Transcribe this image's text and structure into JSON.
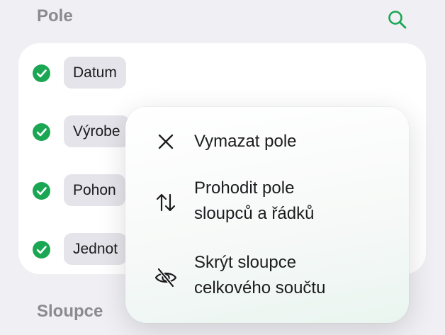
{
  "sections": {
    "fields_title": "Pole",
    "columns_title": "Sloupce"
  },
  "fields": [
    {
      "label": "Datum"
    },
    {
      "label": "Výrobe"
    },
    {
      "label": "Pohon"
    },
    {
      "label": "Jednot"
    }
  ],
  "menu": {
    "items": [
      {
        "icon": "close-icon",
        "line1": "Vymazat pole",
        "line2": ""
      },
      {
        "icon": "swap-arrows-icon",
        "line1": "Prohodit pole",
        "line2": "sloupců a řádků"
      },
      {
        "icon": "eye-slash-icon",
        "line1": "Skrýt sloupce",
        "line2": "celkového součtu"
      }
    ]
  },
  "colors": {
    "accent": "#1aa652",
    "background": "#efeff4"
  }
}
